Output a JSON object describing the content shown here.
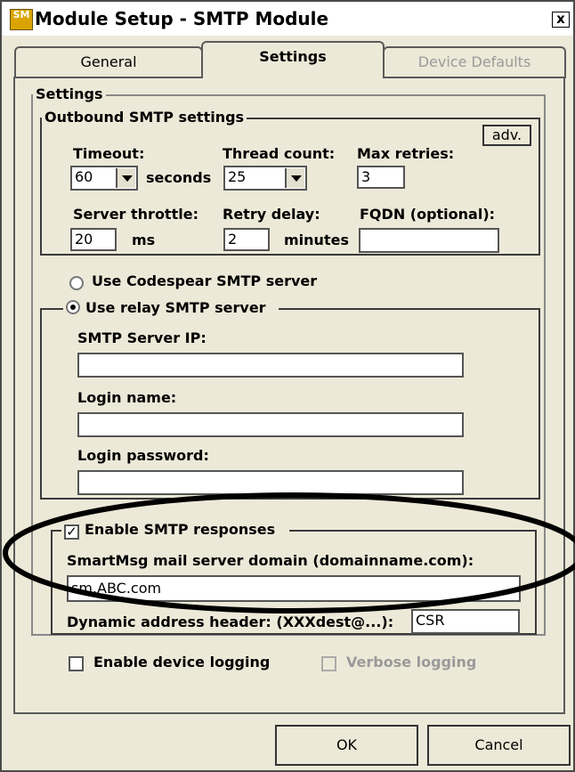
{
  "window": {
    "title": "Module Setup - SMTP Module",
    "icon_text": "SM",
    "close_glyph": "x"
  },
  "tabs": [
    {
      "label": "General",
      "state": "inactive"
    },
    {
      "label": "Settings",
      "state": "active"
    },
    {
      "label": "Device Defaults",
      "state": "disabled"
    }
  ],
  "settings": {
    "group_label": "Settings",
    "outbound": {
      "group_label": "Outbound SMTP settings",
      "adv_label": "adv.",
      "timeout_label": "Timeout:",
      "timeout_value": "60",
      "timeout_unit": "seconds",
      "thread_count_label": "Thread count:",
      "thread_count_value": "25",
      "max_retries_label": "Max retries:",
      "max_retries_value": "3",
      "server_throttle_label": "Server throttle:",
      "server_throttle_value": "20",
      "server_throttle_unit": "ms",
      "retry_delay_label": "Retry delay:",
      "retry_delay_value": "2",
      "retry_delay_unit": "minutes",
      "fqdn_label": "FQDN (optional):",
      "fqdn_value": ""
    },
    "server_choice": {
      "codespear_label": "Use Codespear SMTP server",
      "codespear_selected": false,
      "relay_label": "Use relay SMTP server",
      "relay_selected": true
    },
    "relay": {
      "server_ip_label": "SMTP Server IP:",
      "server_ip_value": "",
      "login_name_label": "Login name:",
      "login_name_value": "",
      "login_password_label": "Login password:",
      "login_password_value": ""
    },
    "responses": {
      "enable_label": "Enable SMTP responses",
      "enabled": true,
      "domain_label": "SmartMsg mail server domain (domainname.com):",
      "domain_value": "sm.ABC.com",
      "dynamic_header_label": "Dynamic address header: (XXXdest@...):",
      "dynamic_header_value": "CSR"
    },
    "logging": {
      "device_logging_label": "Enable device logging",
      "device_logging_checked": false,
      "verbose_logging_label": "Verbose logging",
      "verbose_logging_checked": false
    }
  },
  "buttons": {
    "ok_label": "OK",
    "cancel_label": "Cancel"
  },
  "colors": {
    "dialog_face": "#ece9d8",
    "annotation_ellipse": "#000000"
  }
}
